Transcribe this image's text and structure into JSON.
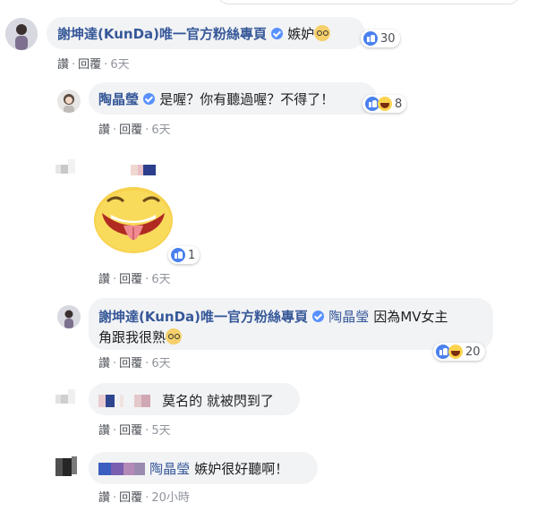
{
  "comments": [
    {
      "author": "謝坤達(KunDa)唯一官方粉絲專頁",
      "text": "嫉妒",
      "reaction_count": "30",
      "actions": {
        "like": "讚",
        "reply": "回覆",
        "time": "6天"
      }
    },
    {
      "author": "陶晶瑩",
      "text": "是喔？你有聽過喔？不得了！",
      "reaction_count": "8",
      "actions": {
        "like": "讚",
        "reply": "回覆",
        "time": "6天"
      }
    },
    {
      "author": "",
      "text": "",
      "reaction_count": "1",
      "actions": {
        "like": "讚",
        "reply": "回覆",
        "time": "6天"
      }
    },
    {
      "author": "謝坤達(KunDa)唯一官方粉絲專頁",
      "mention": "陶晶瑩",
      "text_line1": "因為MV女主",
      "text_line2": "角跟我很熟",
      "reaction_count": "20",
      "actions": {
        "like": "讚",
        "reply": "回覆",
        "time": "6天"
      }
    },
    {
      "author": "",
      "text": "莫名的 就被閃到了",
      "actions": {
        "like": "讚",
        "reply": "回覆",
        "time": "5天"
      }
    },
    {
      "author": "",
      "mention": "陶晶瑩",
      "text": "嫉妒很好聽啊！",
      "actions": {
        "like": "讚",
        "reply": "回覆",
        "time": "20小時"
      }
    }
  ],
  "colors": {
    "link": "#365899",
    "bubble": "#f2f3f5",
    "like_blue": "#4a81ef",
    "meta": "#90949c"
  },
  "icons": [
    "verified-badge-icon",
    "like-reaction-icon",
    "haha-reaction-icon",
    "nerd-face-emoji",
    "tongue-out-sticker"
  ]
}
